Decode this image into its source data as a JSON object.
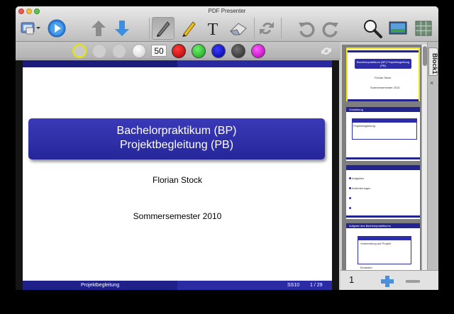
{
  "window": {
    "title": "PDF Presenter"
  },
  "toolbar": {
    "icons": [
      "display-settings-icon",
      "play-icon",
      "arrow-up-icon",
      "arrow-down-icon",
      "pen-icon",
      "marker-icon",
      "text-icon",
      "eraser-icon",
      "swap-icon",
      "undo-icon",
      "redo-icon",
      "zoom-icon",
      "monitor-icon",
      "grid-icon"
    ]
  },
  "penbar": {
    "size_value": "50",
    "colors": [
      "#c00000",
      "#20c020",
      "#0000b8",
      "#3a3a3a",
      "#d000d0"
    ]
  },
  "slide": {
    "title_line1": "Bachelorpraktikum (BP)",
    "title_line2": "Projektbegleitung (PB)",
    "author": "Florian Stock",
    "term": "Sommersemester 2010",
    "footer_left": "Projektbegleitung",
    "footer_course": "SS10",
    "footer_page": "1 / 29"
  },
  "sidebar": {
    "tab_label": "Block1",
    "tab_close": "×",
    "page_number": "1",
    "thumbs": [
      {
        "title": "Bachelorpraktikum (BP) Projektbegleitung (PB)",
        "line1": "Florian Stock",
        "line2": "Sommersemester 2010"
      },
      {
        "title": "Vorstellung",
        "line1": "Projektbegleitung",
        "line2": ""
      },
      {
        "title": "",
        "line1": "Aufgaben",
        "line2": "Anforderungen"
      },
      {
        "title": "Aufgabe des Bachelorpraktikums",
        "line1": "Vorbereitung auf Projekt",
        "line2": "Einheiten"
      }
    ]
  },
  "colors": {
    "slide_blue": "#26269a",
    "selection": "#f2e318"
  }
}
